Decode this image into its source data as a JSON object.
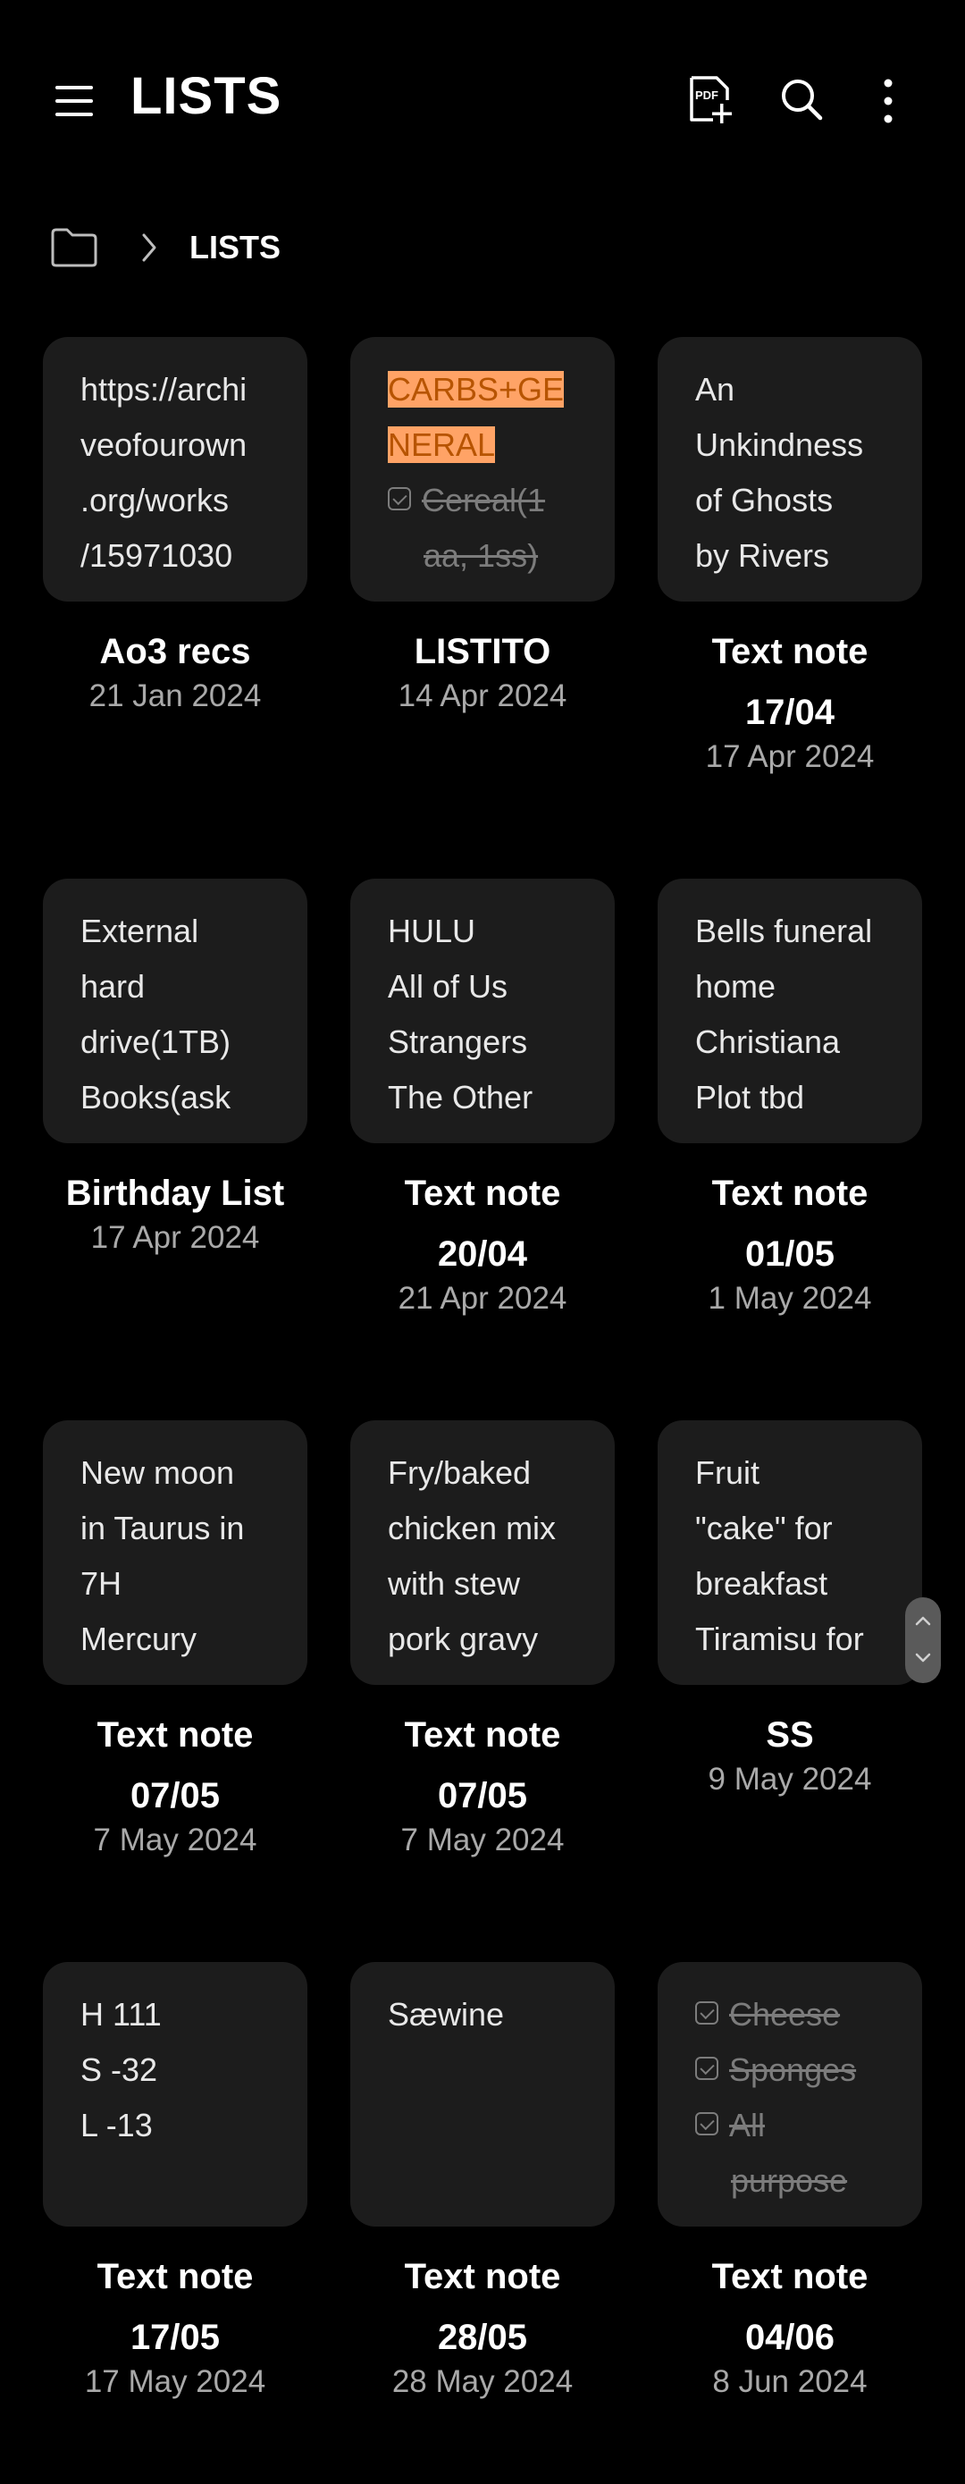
{
  "header": {
    "title": "LISTS",
    "icons": [
      "menu-icon",
      "pdf-add-icon",
      "search-icon",
      "more-vertical-icon"
    ]
  },
  "breadcrumb": {
    "current": "LISTS",
    "icons": [
      "folder-icon",
      "chevron-right-icon"
    ]
  },
  "colors": {
    "background": "#000000",
    "card": "#1c1c1c",
    "highlight": "#ffa366",
    "highlight_text": "#b75400",
    "date_text": "#a9a9a9"
  },
  "notes": [
    {
      "preview": [
        "https://archi",
        "veofourown",
        ".org/works",
        "/15971030"
      ],
      "title": [
        "Ao3 recs"
      ],
      "date": "21 Jan 2024"
    },
    {
      "preview": [
        "CARBS+GE",
        "NERAL",
        "Cereal(1",
        "aa, 1ss)"
      ],
      "title": [
        "LISTITO"
      ],
      "date": "14 Apr 2024"
    },
    {
      "preview": [
        "An",
        "Unkindness",
        "of Ghosts",
        "by Rivers"
      ],
      "title": [
        "Text note",
        "17/04"
      ],
      "date": "17 Apr 2024"
    },
    {
      "preview": [
        "External",
        "hard",
        "drive(1TB)",
        "Books(ask"
      ],
      "title": [
        "Birthday List"
      ],
      "date": "17 Apr 2024"
    },
    {
      "preview": [
        "HULU",
        "All of Us",
        "Strangers",
        "The Other"
      ],
      "title": [
        "Text note",
        "20/04"
      ],
      "date": "21 Apr 2024"
    },
    {
      "preview": [
        "Bells funeral",
        "home",
        "Christiana",
        "Plot tbd"
      ],
      "title": [
        "Text note",
        "01/05"
      ],
      "date": "1 May 2024"
    },
    {
      "preview": [
        "New moon",
        "in Taurus in",
        "7H",
        "Mercury"
      ],
      "title": [
        "Text note",
        "07/05"
      ],
      "date": "7 May 2024"
    },
    {
      "preview": [
        "Fry/baked",
        "chicken mix",
        "with stew",
        "pork gravy"
      ],
      "title": [
        "Text note",
        "07/05"
      ],
      "date": "7 May 2024"
    },
    {
      "preview": [
        "Fruit",
        "\"cake\" for",
        "breakfast",
        "Tiramisu for"
      ],
      "title": [
        "SS"
      ],
      "date": "9 May 2024"
    },
    {
      "preview": [
        "H 111",
        "S -32",
        "L -13"
      ],
      "title": [
        "Text note",
        "17/05"
      ],
      "date": "17 May 2024"
    },
    {
      "preview": [
        "Sæwine"
      ],
      "title": [
        "Text note",
        "28/05"
      ],
      "date": "28 May 2024"
    },
    {
      "preview": [
        "Cheese",
        "Sponges",
        "All",
        "purpose"
      ],
      "title": [
        "Text note",
        "04/06"
      ],
      "date": "8 Jun 2024"
    }
  ]
}
